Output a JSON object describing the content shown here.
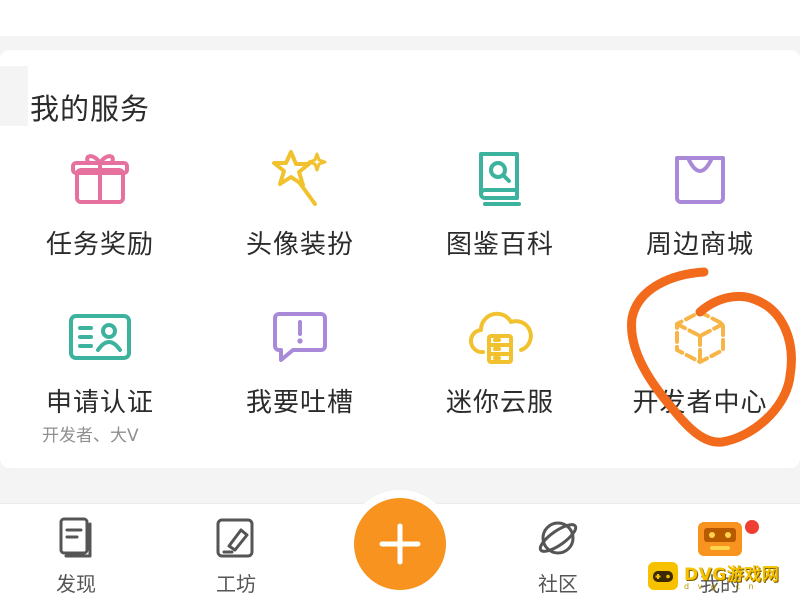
{
  "section": {
    "title": "我的服务"
  },
  "services": [
    {
      "label": "任务奖励",
      "icon": "gift-icon",
      "color": "#e6709e"
    },
    {
      "label": "头像装扮",
      "icon": "star-wand-icon",
      "color": "#f2c12e"
    },
    {
      "label": "图鉴百科",
      "icon": "encyclopedia-icon",
      "color": "#3db39e"
    },
    {
      "label": "周边商城",
      "icon": "shopping-bag-icon",
      "color": "#a98ad9"
    },
    {
      "label": "申请认证",
      "sub": "开发者、大V",
      "icon": "id-card-icon",
      "color": "#3db39e"
    },
    {
      "label": "我要吐槽",
      "icon": "feedback-bubble-icon",
      "color": "#a98ad9"
    },
    {
      "label": "迷你云服",
      "icon": "cloud-server-icon",
      "color": "#f2c12e"
    },
    {
      "label": "开发者中心",
      "icon": "cube-icon",
      "color": "#f7b548"
    }
  ],
  "tabbar": {
    "tabs": [
      {
        "label": "发现",
        "icon": "discover-icon"
      },
      {
        "label": "工坊",
        "icon": "workshop-icon"
      },
      {
        "label": "社区",
        "icon": "planet-icon"
      },
      {
        "label": "我的",
        "icon": "profile-avatar-icon"
      }
    ],
    "plus_icon": "plus-icon",
    "accent": "#f7931e"
  },
  "annotation": {
    "color": "#f26a1b"
  },
  "watermark": {
    "text": "DVG游戏网",
    "sub": "d v g . c n"
  }
}
